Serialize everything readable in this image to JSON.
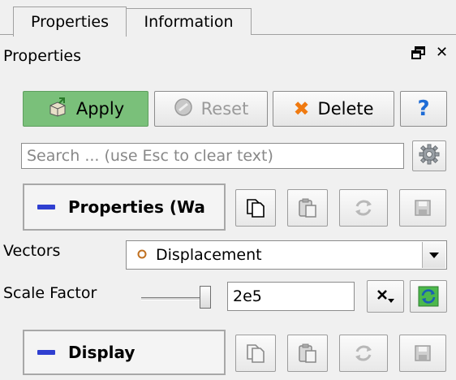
{
  "tabs": [
    {
      "label": "Properties",
      "active": true
    },
    {
      "label": "Information",
      "active": false
    }
  ],
  "dock": {
    "title": "Properties",
    "float_icon": "float-icon",
    "close_icon": "close-icon"
  },
  "toolbar": {
    "apply_label": "Apply",
    "reset_label": "Reset",
    "delete_label": "Delete",
    "help_label": "?"
  },
  "search": {
    "placeholder": "Search ... (use Esc to clear text)",
    "settings_icon": "gear-icon"
  },
  "sections": {
    "properties_title": "Properties (Wa",
    "display_title": "Display"
  },
  "vectors": {
    "label": "Vectors",
    "value": "Displacement",
    "value_icon": "point-data-icon"
  },
  "scale_factor": {
    "label": "Scale Factor",
    "value": "2e5"
  },
  "colors": {
    "apply": "#7ac07a",
    "section_minus": "#2f3fd0",
    "delete_x": "#f07a10",
    "help": "#1e6cd6"
  }
}
